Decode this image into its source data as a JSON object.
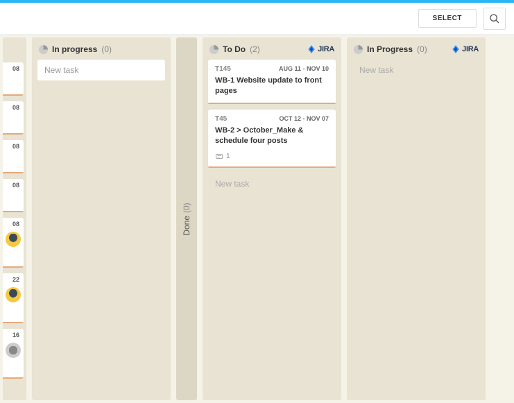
{
  "toolbar": {
    "select_label": "SELECT"
  },
  "columns": {
    "partial_left": {
      "stubs": [
        {
          "date": "08"
        },
        {
          "date": "08"
        },
        {
          "date": "08"
        },
        {
          "date": "08"
        },
        {
          "date": "08",
          "avatar": "yellow",
          "tall": true
        },
        {
          "date": "22",
          "avatar": "yellow",
          "tall": true
        },
        {
          "date": "16",
          "avatar": "grey",
          "tall": true
        }
      ]
    },
    "in_progress_1": {
      "title": "In progress",
      "count": "(0)",
      "new_task_label": "New task"
    },
    "done": {
      "title": "Done",
      "count": "(0)"
    },
    "to_do": {
      "title": "To Do",
      "count": "(2)",
      "integration": "JIRA",
      "new_task_label": "New task",
      "cards": [
        {
          "id": "T145",
          "dates": "AUG 11 - NOV 10",
          "title": "WB-1 Website update to front pages"
        },
        {
          "id": "T45",
          "dates": "OCT 12 - NOV 07",
          "title": "WB-2 > October_Make & schedule four posts",
          "comments": "1"
        }
      ]
    },
    "in_progress_2": {
      "title": "In Progress",
      "count": "(0)",
      "integration": "JIRA",
      "new_task_label": "New task"
    }
  }
}
